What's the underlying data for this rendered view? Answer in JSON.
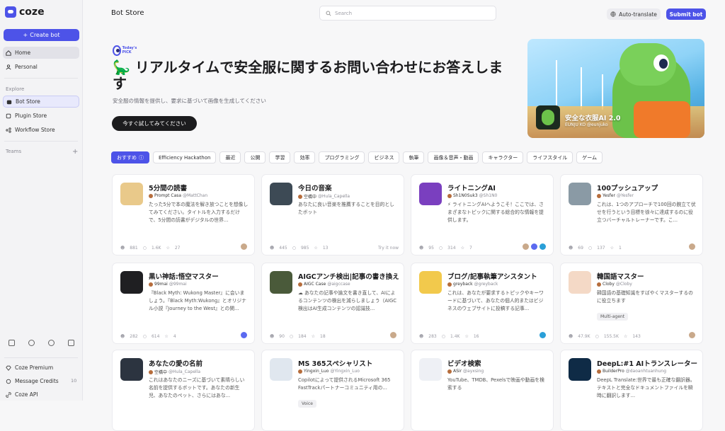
{
  "app": {
    "name": "coze"
  },
  "sidebar": {
    "create_label": "Create bot",
    "nav": [
      {
        "label": "Home"
      },
      {
        "label": "Personal"
      }
    ],
    "explore_label": "Explore",
    "explore": [
      {
        "label": "Bot Store"
      },
      {
        "label": "Plugin Store"
      },
      {
        "label": "Workflow Store"
      }
    ],
    "teams_label": "Teams",
    "bottom": [
      {
        "label": "Coze Premium"
      },
      {
        "label": "Message Credits",
        "count": "10"
      },
      {
        "label": "Coze API"
      }
    ]
  },
  "header": {
    "title": "Bot Store",
    "search_placeholder": "Search",
    "auto_translate": "Auto-translate",
    "submit": "Submit bot"
  },
  "hero": {
    "badge": "Today's PICK",
    "title": "🦕 リアルタイムで安全服に関するお問い合わせにお答えします",
    "subtitle": "安全服の情報を提供し、要求に基づいて画像を生成してください",
    "cta": "今すぐ試してみてください",
    "card_name": "安全な衣服AI 2.0",
    "card_author": "EUNJU KO @eunjuko"
  },
  "tabs": [
    {
      "label": "おすすめ"
    },
    {
      "label": "Efficiency Hackathon"
    },
    {
      "label": "最近"
    },
    {
      "label": "公開"
    },
    {
      "label": "学習"
    },
    {
      "label": "効率"
    },
    {
      "label": "プログラミング"
    },
    {
      "label": "ビジネス"
    },
    {
      "label": "執筆"
    },
    {
      "label": "画像＆音声・動画"
    },
    {
      "label": "キャラクター"
    },
    {
      "label": "ライフスタイル"
    },
    {
      "label": "ゲーム"
    }
  ],
  "cards": [
    {
      "name": "5分間の読書",
      "author": "Prompt Casa",
      "handle": "@MattChan",
      "desc": "たった5分で本の魔法を解き放つことを想像してみてください。タイトルを入力するだけで、5分間の読書がデジタルの世界...",
      "users": "881",
      "chats": "1.6K",
      "stars": "27",
      "av_color": "#e9c98a"
    },
    {
      "name": "今日の音楽",
      "author": "空橋中",
      "handle": "@Hula_Capella",
      "desc": "あなたに良い音楽を推薦することを目的としたボット",
      "users": "445",
      "chats": "985",
      "stars": "13",
      "tryit": "Try it now",
      "av_color": "#3d4a55"
    },
    {
      "name": "ライトニングAI",
      "author": "Sh1N0Suk3",
      "handle": "@Sh1N0",
      "desc": "⚡ ライトニングAIへようこそ！ここでは、さまざまなトピックに関する総合的な情報を提供します。",
      "users": "95",
      "chats": "314",
      "stars": "7",
      "av_color": "#7a3fbf"
    },
    {
      "name": "100プッシュアップ",
      "author": "Yesfer",
      "handle": "@Yesfer",
      "desc": "これは、1つのアプローチで100回の腕立て伏せを行うという目標を徐々に達成するのに役立つバーチャルトレーナーです。こ...",
      "users": "69",
      "chats": "137",
      "stars": "1",
      "av_color": "#8a9aa5"
    },
    {
      "name": "黒い神話:悟空マスター",
      "author": "99mai",
      "handle": "@99mai",
      "desc": "『Black Myth: Wukong Master』に会いましょう。『Black Myth:Wukong』とオリジナル小説『Journey to the West』との関...",
      "users": "282",
      "chats": "614",
      "stars": "4",
      "av_color": "#1f1f22"
    },
    {
      "name": "AIGCアンチ検出|記事の書き換え",
      "author": "AIGC Case",
      "handle": "@aigccase",
      "desc": "☁ あなたの記事や論文を書き直して、AIによるコンテンツの検出を減らしましょう（AIGC検出はAI生成コンテンツの認識技...",
      "users": "90",
      "chats": "184",
      "stars": "18",
      "av_color": "#4a5a3a"
    },
    {
      "name": "ブログ/記事執筆アシスタント",
      "author": "greyback",
      "handle": "@greyback",
      "desc": "これは、あなたが要求するトピックやキーワードに基づいて、あなたの個人的またはビジネスのウェブサイトに投稿する記事...",
      "users": "283",
      "chats": "1.4K",
      "stars": "16",
      "av_color": "#f2c94c"
    },
    {
      "name": "韓国語マスター",
      "author": "Cloby",
      "handle": "@Cloby",
      "desc": "韓国語の基礎知識をすばやくマスターするのに役立ちます",
      "chip": "Multi-agent",
      "users": "47.9K",
      "chats": "155.5K",
      "stars": "143",
      "av_color": "#f4d9c6"
    },
    {
      "name": "あなたの愛の名前",
      "author": "空橋中",
      "handle": "@Hula_Capella",
      "desc": "これはあなたのニーズに基づいて素晴らしい名前を提供するボットです。あなたの新生児、あなたのペット、さらにはあな...",
      "av_color": "#2c3440"
    },
    {
      "name": "MS 365スペシャリスト",
      "author": "Yingxin_Luo",
      "handle": "@Yingxin_Luo",
      "desc": "Copilotによって提供されるMicrosoft 365 FastTrackパートナーコミュニティ用の...",
      "chip": "Voice",
      "av_color": "#e0e7ef"
    },
    {
      "name": "ビデオ検索",
      "author": "ASir",
      "handle": "@ayxsing",
      "desc": "YouTube、TMDB、Pexelsで映画や動画を検索する",
      "av_color": "#eef0f5"
    },
    {
      "name": "DeepL:#1 AIトランスレーター",
      "author": "BuilderPro",
      "handle": "@daoanhtuanhung",
      "desc": "DeepL Translate:世界で最も正確な翻訳器。テキストと完全なドキュメントファイルを瞬時に翻訳します...",
      "av_color": "#0f2b46"
    }
  ]
}
